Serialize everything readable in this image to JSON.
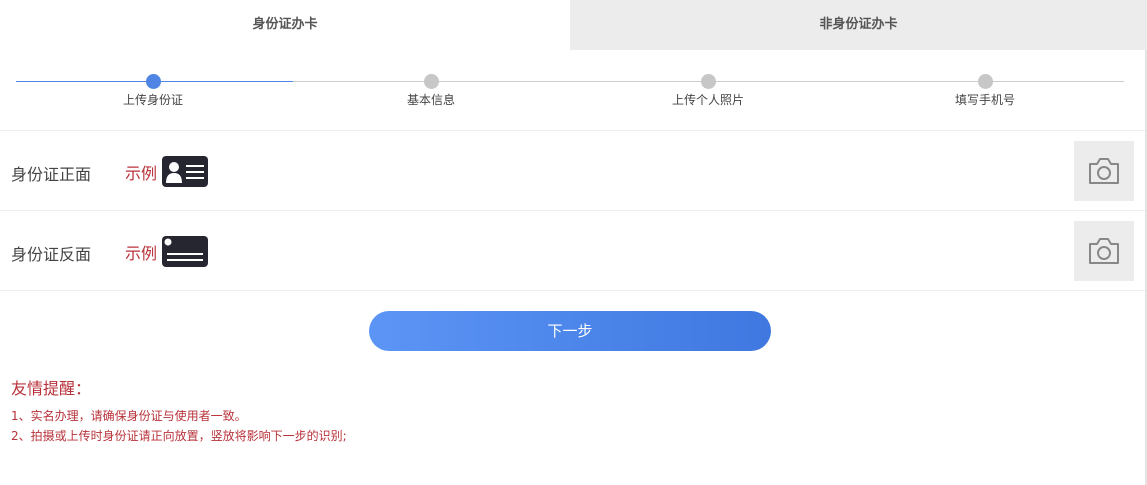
{
  "tabs": [
    {
      "label": "身份证办卡",
      "active": true
    },
    {
      "label": "非身份证办卡",
      "active": false
    }
  ],
  "steps": [
    {
      "label": "上传身份证",
      "active": true
    },
    {
      "label": "基本信息",
      "active": false
    },
    {
      "label": "上传个人照片",
      "active": false
    },
    {
      "label": "填写手机号",
      "active": false
    }
  ],
  "uploads": [
    {
      "label": "身份证正面",
      "sample": "示例",
      "icon": "id-card-front-icon",
      "camera_icon": "camera-icon"
    },
    {
      "label": "身份证反面",
      "sample": "示例",
      "icon": "id-card-back-icon",
      "camera_icon": "camera-icon"
    }
  ],
  "next_button": "下一步",
  "tips": {
    "title": "友情提醒：",
    "items": [
      "1、实名办理，请确保身份证与使用者一致。",
      "2、拍摄或上传时身份证请正向放置，竖放将影响下一步的识别;"
    ]
  },
  "colors": {
    "accent": "#4f86e6",
    "warning": "#b8323a",
    "inactive_tab": "#ececec",
    "card_icon": "#262631"
  }
}
